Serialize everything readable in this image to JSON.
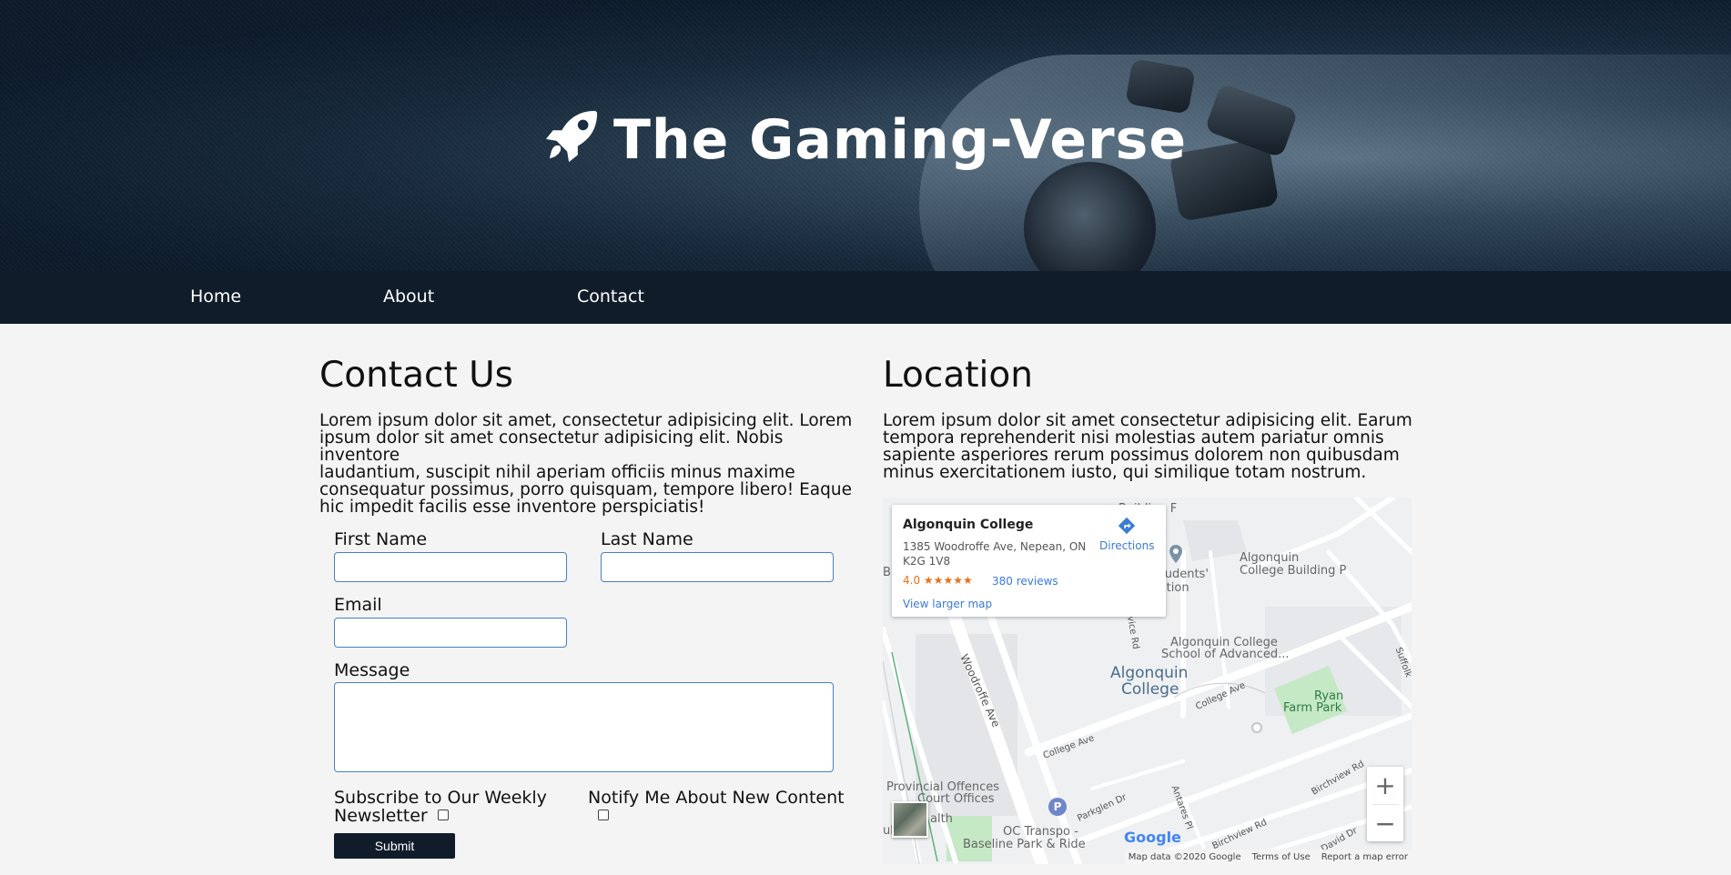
{
  "site": {
    "title": "The Gaming-Verse"
  },
  "nav": {
    "items": [
      "Home",
      "About",
      "Contact"
    ]
  },
  "contact": {
    "heading": "Contact Us",
    "lines": [
      "Lorem ipsum dolor sit amet, consectetur adipisicing elit. Lorem",
      "ipsum dolor sit amet consectetur adipisicing elit. Nobis inventore",
      "laudantium, suscipit nihil aperiam officiis minus maxime",
      "consequatur possimus, porro quisquam, tempore libero! Eaque",
      "hic impedit facilis esse inventore perspiciatis!"
    ],
    "form": {
      "first_name_label": "First Name",
      "last_name_label": "Last Name",
      "email_label": "Email",
      "message_label": "Message",
      "subscribe_line1": "Subscribe to Our Weekly",
      "subscribe_line2": "Newsletter",
      "notify_label": "Notify Me About New Content",
      "submit_label": "Submit"
    }
  },
  "location": {
    "heading": "Location",
    "lines": [
      "Lorem ipsum dolor sit amet consectetur adipisicing elit. Earum",
      "tempora reprehenderit nisi molestias autem pariatur omnis",
      "sapiente asperiores rerum possimus dolorem non quibusdam",
      "minus exercitationem iusto, qui similique totam nostrum."
    ]
  },
  "map": {
    "card": {
      "place": "Algonquin College",
      "address_line1": "1385 Woodroffe Ave, Nepean, ON",
      "address_line2": "K2G 1V8",
      "rating": "4.0",
      "stars": "★★★★★",
      "reviews": "380 reviews",
      "directions": "Directions",
      "larger_map": "View larger map"
    },
    "labels": {
      "building_f": "- Building F",
      "building_p1": "Algonquin",
      "building_p2": "College Building P",
      "students1": "n Students'",
      "students2": "ociation",
      "school1": "Algonquin College",
      "school2": "School of Advanced...",
      "college1": "Algonquin",
      "college2": "College",
      "ryan1": "Ryan",
      "ryan2": "Farm Park",
      "woodroffe": "Woodroffe Ave",
      "service": "Service Rd",
      "college_ave1": "College Ave",
      "college_ave2": "College Ave",
      "provincial1": "Provincial Offences",
      "provincial2": "Court Offices",
      "parkglen": "Parkglen Dr",
      "antares": "Antares Pl",
      "birchview1": "Birchview Rd",
      "birchview2": "Birchview Rd",
      "david": "David Dr",
      "suffolk": "Suffolk",
      "octranspo1": "OC Transpo -",
      "octranspo2": "Baseline Park & Ride",
      "health": "alth",
      "edge_b": "B",
      "edge_u": "ub",
      "parking": "P",
      "zoom_in": "+",
      "zoom_out": "−",
      "google": "Google",
      "attribution": "Map data ©2020 Google",
      "terms": "Terms of Use",
      "report": "Report a map error"
    },
    "colors": {
      "google_blue": "#4285F4",
      "google_red": "#EA4335",
      "google_yellow": "#FBBC05",
      "google_green": "#34A853",
      "park": "#c5e8c5",
      "rating": "#e7711b"
    }
  }
}
